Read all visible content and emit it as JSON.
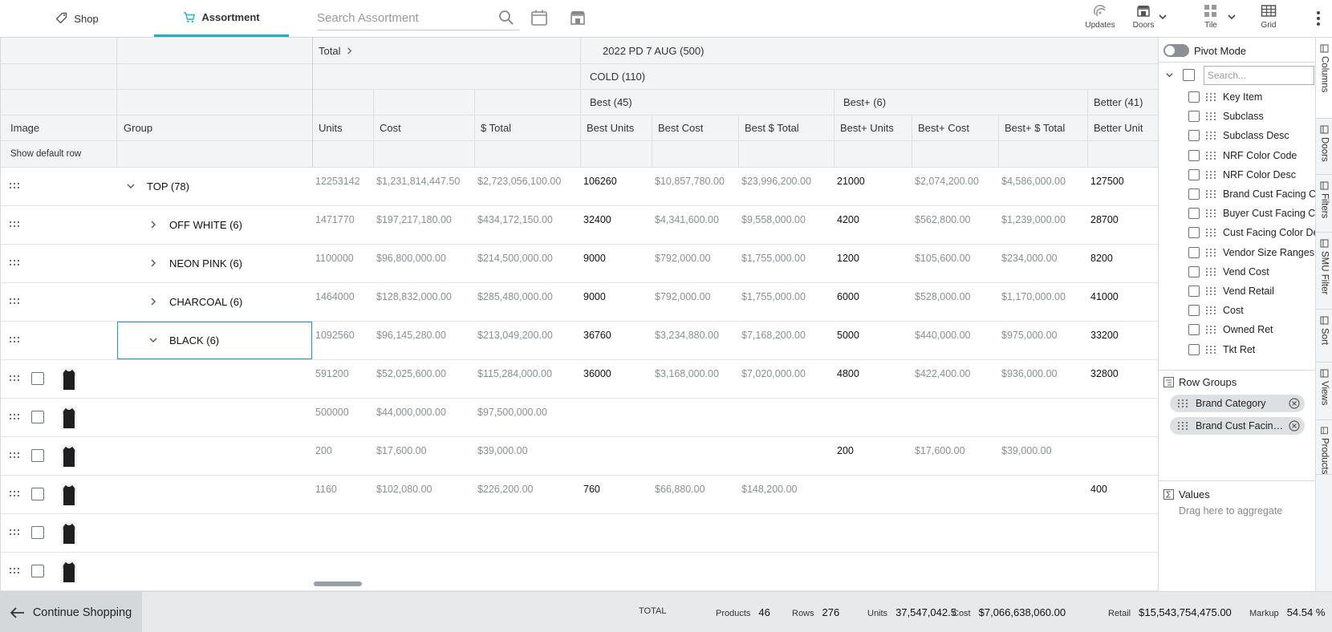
{
  "topbar": {
    "tabs": [
      {
        "label": "Shop",
        "icon": "tag-icon"
      },
      {
        "label": "Assortment",
        "icon": "cart-icon"
      }
    ],
    "search_placeholder": "Search Assortment",
    "tools": [
      {
        "label": "Updates",
        "icon": "updates-icon"
      },
      {
        "label": "Doors",
        "icon": "store-icon"
      },
      {
        "label": "Tile",
        "icon": "tile-icon"
      },
      {
        "label": "Grid",
        "icon": "grid-icon"
      }
    ]
  },
  "grid": {
    "header_row1": {
      "total": "Total",
      "period": "2022 PD 7 AUG (500)"
    },
    "header_row2": {
      "group": "COLD (110)"
    },
    "header_row3": {
      "best": "Best (45)",
      "bestplus": "Best+ (6)",
      "better": "Better (41)"
    },
    "columns": {
      "image": "Image",
      "group": "Group",
      "units": "Units",
      "cost": "Cost",
      "total": "$ Total",
      "best_units": "Best Units",
      "best_cost": "Best Cost",
      "best_total": "Best $ Total",
      "bestp_units": "Best+ Units",
      "bestp_cost": "Best+ Cost",
      "bestp_total": "Best+ $ Total",
      "better_units": "Better Unit"
    },
    "default_row_label": "Show default row",
    "rows": [
      {
        "group": "TOP (78)",
        "expanded": true,
        "level": 0,
        "units": "12253142",
        "cost": "$1,231,814,447.50",
        "total": "$2,723,056,100.00",
        "best_units": "106260",
        "best_cost": "$10,857,780.00",
        "best_total": "$23,996,200.00",
        "bestp_units": "21000",
        "bestp_cost": "$2,074,200.00",
        "bestp_total": "$4,586,000.00",
        "better_units": "127500"
      },
      {
        "group": "OFF WHITE (6)",
        "expanded": false,
        "level": 1,
        "units": "1471770",
        "cost": "$197,217,180.00",
        "total": "$434,172,150.00",
        "best_units": "32400",
        "best_cost": "$4,341,600.00",
        "best_total": "$9,558,000.00",
        "bestp_units": "4200",
        "bestp_cost": "$562,800.00",
        "bestp_total": "$1,239,000.00",
        "better_units": "28700"
      },
      {
        "group": "NEON PINK (6)",
        "expanded": false,
        "level": 1,
        "units": "1100000",
        "cost": "$96,800,000.00",
        "total": "$214,500,000.00",
        "best_units": "9000",
        "best_cost": "$792,000.00",
        "best_total": "$1,755,000.00",
        "bestp_units": "1200",
        "bestp_cost": "$105,600.00",
        "bestp_total": "$234,000.00",
        "better_units": "8200"
      },
      {
        "group": "CHARCOAL (6)",
        "expanded": false,
        "level": 1,
        "units": "1464000",
        "cost": "$128,832,000.00",
        "total": "$285,480,000.00",
        "best_units": "9000",
        "best_cost": "$792,000.00",
        "best_total": "$1,755,000.00",
        "bestp_units": "6000",
        "bestp_cost": "$528,000.00",
        "bestp_total": "$1,170,000.00",
        "better_units": "41000"
      },
      {
        "group": "BLACK (6)",
        "expanded": true,
        "level": 1,
        "units": "1092560",
        "cost": "$96,145,280.00",
        "total": "$213,049,200.00",
        "best_units": "36760",
        "best_cost": "$3,234,880.00",
        "best_total": "$7,168,200.00",
        "bestp_units": "5000",
        "bestp_cost": "$440,000.00",
        "bestp_total": "$975,000.00",
        "better_units": "33200"
      },
      {
        "product": true,
        "units": "591200",
        "cost": "$52,025,600.00",
        "total": "$115,284,000.00",
        "best_units": "36000",
        "best_cost": "$3,168,000.00",
        "best_total": "$7,020,000.00",
        "bestp_units": "4800",
        "bestp_cost": "$422,400.00",
        "bestp_total": "$936,000.00",
        "better_units": "32800"
      },
      {
        "product": true,
        "units": "500000",
        "cost": "$44,000,000.00",
        "total": "$97,500,000.00",
        "best_units": "",
        "best_cost": "",
        "best_total": "",
        "bestp_units": "",
        "bestp_cost": "",
        "bestp_total": "",
        "better_units": ""
      },
      {
        "product": true,
        "units": "200",
        "cost": "$17,600.00",
        "total": "$39,000.00",
        "best_units": "",
        "best_cost": "",
        "best_total": "",
        "bestp_units": "200",
        "bestp_cost": "$17,600.00",
        "bestp_total": "$39,000.00",
        "better_units": ""
      },
      {
        "product": true,
        "units": "1160",
        "cost": "$102,080.00",
        "total": "$226,200.00",
        "best_units": "760",
        "best_cost": "$66,880.00",
        "best_total": "$148,200.00",
        "bestp_units": "",
        "bestp_cost": "",
        "bestp_total": "",
        "better_units": "400"
      },
      {
        "product": true,
        "units": "",
        "cost": "",
        "total": "",
        "best_units": "",
        "best_cost": "",
        "best_total": "",
        "bestp_units": "",
        "bestp_cost": "",
        "bestp_total": "",
        "better_units": ""
      },
      {
        "product": true,
        "units": "",
        "cost": "",
        "total": "",
        "best_units": "",
        "best_cost": "",
        "best_total": "",
        "bestp_units": "",
        "bestp_cost": "",
        "bestp_total": "",
        "better_units": ""
      }
    ]
  },
  "panel": {
    "pivot_label": "Pivot Mode",
    "search_placeholder": "Search...",
    "columns": [
      "Key Item",
      "Subclass",
      "Subclass Desc",
      "NRF Color Code",
      "NRF Color Desc",
      "Brand Cust Facing Color",
      "Buyer Cust Facing Color",
      "Cust Facing Color Desc",
      "Vendor Size Ranges",
      "Vend Cost",
      "Vend Retail",
      "Cost",
      "Owned Ret",
      "Tkt Ret"
    ],
    "row_groups_title": "Row Groups",
    "row_groups": [
      "Brand Category",
      "Brand Cust Facing Color"
    ],
    "values_title": "Values",
    "values_hint": "Drag here to aggregate"
  },
  "sidetabs": [
    "Columns",
    "Doors",
    "Filters",
    "SMU Filter",
    "Sort",
    "Views",
    "Products"
  ],
  "footer": {
    "continue_label": "Continue Shopping",
    "total_label": "TOTAL",
    "stats": [
      {
        "label": "Products",
        "value": "46"
      },
      {
        "label": "Rows",
        "value": "276"
      },
      {
        "label": "Units",
        "value": "37,547,042.5"
      },
      {
        "label": "Cost",
        "value": "$7,066,638,060.00"
      },
      {
        "label": "Retail",
        "value": "$15,543,754,475.00"
      },
      {
        "label": "Markup",
        "value": "54.54 %"
      }
    ]
  },
  "colors": {
    "accent": "#1bb3bd",
    "highlight": "#e8f5fb",
    "selection": "#2a8fd6"
  }
}
